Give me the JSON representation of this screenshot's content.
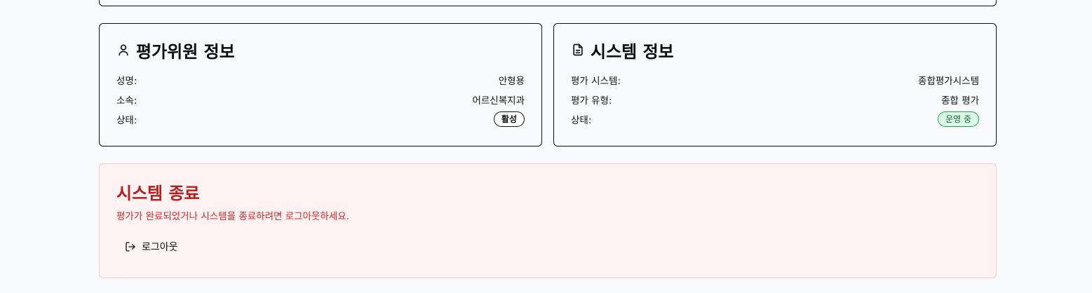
{
  "evaluator": {
    "title": "평가위원 정보",
    "rows": [
      {
        "label": "성명:",
        "value": "안형용"
      },
      {
        "label": "소속:",
        "value": "어르신복지과"
      }
    ],
    "status_label": "상태:",
    "status_badge": "활성"
  },
  "system": {
    "title": "시스템 정보",
    "rows": [
      {
        "label": "평가 시스템:",
        "value": "종합평가시스템"
      },
      {
        "label": "평가 유형:",
        "value": "종합 평가"
      }
    ],
    "status_label": "상태:",
    "status_badge": "운영 중"
  },
  "exit": {
    "title": "시스템 종료",
    "description": "평가가 완료되었거나 시스템을 종료하려면 로그아웃하세요.",
    "logout_label": "로그아웃"
  },
  "colors": {
    "danger_text": "#b91c1c",
    "danger_bg": "#fef2f2",
    "success_bg": "#dcfce7",
    "success_text": "#166534"
  },
  "icons": {
    "evaluator": "user-icon",
    "system": "document-icon",
    "logout": "logout-icon"
  }
}
